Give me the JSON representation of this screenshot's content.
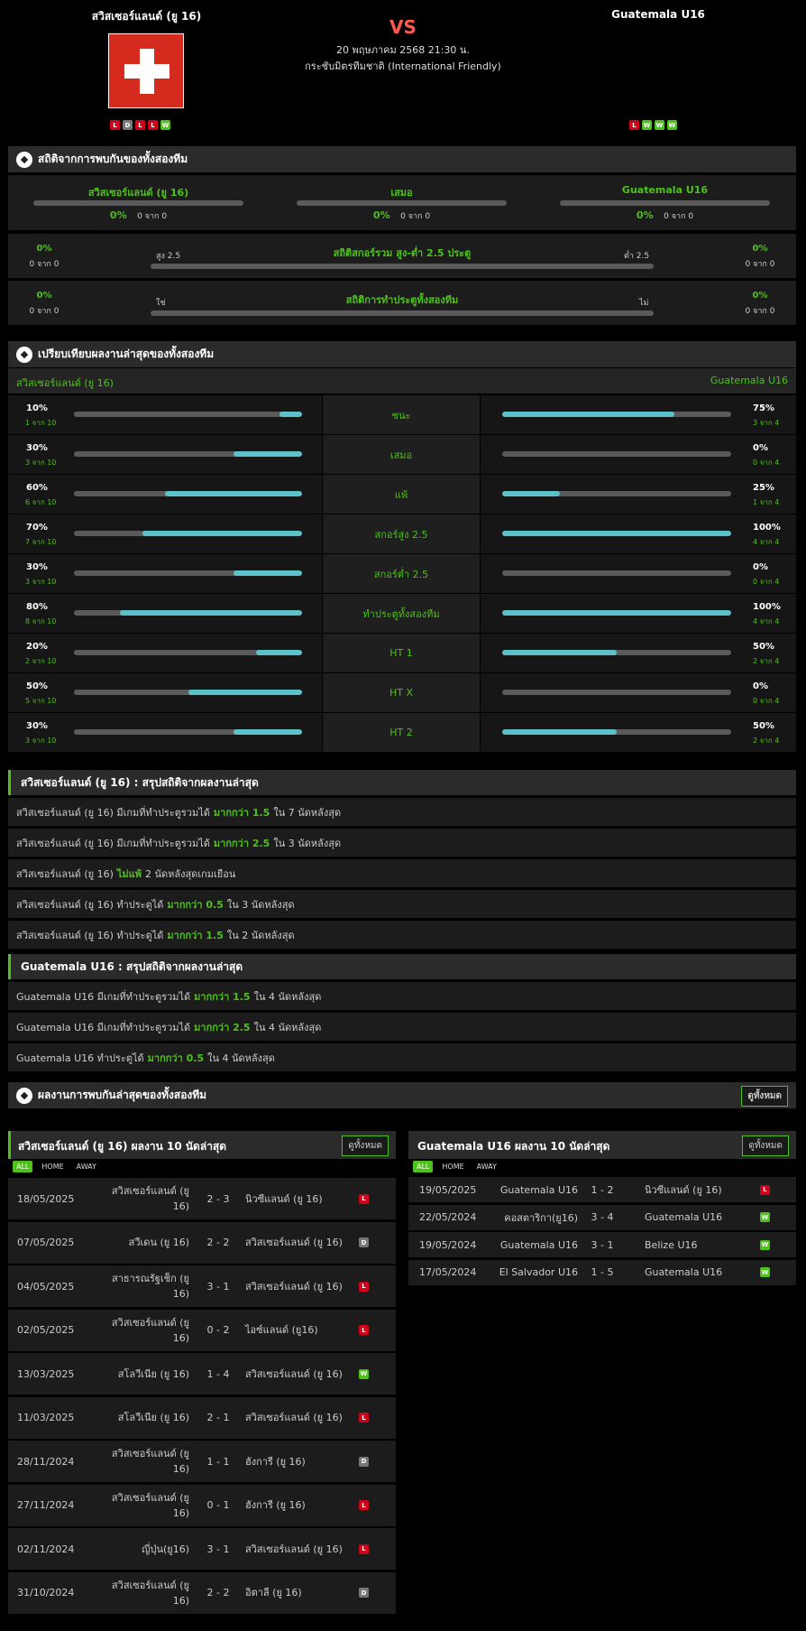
{
  "match": {
    "home": "สวิสเซอร์แลนด์ (ยู 16)",
    "away": "Guatemala U16",
    "vs": "VS",
    "datetime": "20 พฤษภาคม 2568 21:30 น.",
    "competition": "กระชับมิตรทีมชาติ (International Friendly)",
    "home_form": [
      "L",
      "D",
      "L",
      "L",
      "W"
    ],
    "away_form": [
      "L",
      "W",
      "W",
      "W"
    ]
  },
  "h2h": {
    "title": "สถิติจากการพบกันของทั้งสองทีม",
    "cols": [
      {
        "label": "สวิสเซอร์แลนด์ (ยู 16)",
        "pct": "0%",
        "of": "0 จาก 0"
      },
      {
        "label": "เสมอ",
        "pct": "0%",
        "of": "0 จาก 0"
      },
      {
        "label": "Guatemala U16",
        "pct": "0%",
        "of": "0 จาก 0"
      }
    ],
    "ou": {
      "title": "สถิติสกอร์รวม สูง-ต่ำ 2.5 ประตู",
      "left_label": "สูง 2.5",
      "right_label": "ต่ำ 2.5",
      "left_pct": "0%",
      "left_of": "0 จาก 0",
      "right_pct": "0%",
      "right_of": "0 จาก 0"
    },
    "btts": {
      "title": "สถิติการทำประตูทั้งสองทีม",
      "left_label": "ใช่",
      "right_label": "ไม่",
      "left_pct": "0%",
      "left_of": "0 จาก 0",
      "right_pct": "0%",
      "right_of": "0 จาก 0"
    }
  },
  "compare": {
    "title": "เปรียบเทียบผลงานล่าสุดของทั้งสองทีม",
    "home": "สวิสเซอร์แลนด์ (ยู 16)",
    "away": "Guatemala U16",
    "rows": [
      {
        "label": "ชนะ",
        "lp": "10%",
        "lc": "1 จาก 10",
        "lv": 0.1,
        "rp": "75%",
        "rc": "3 จาก 4",
        "rv": 0.75
      },
      {
        "label": "เสมอ",
        "lp": "30%",
        "lc": "3 จาก 10",
        "lv": 0.3,
        "rp": "0%",
        "rc": "0 จาก 4",
        "rv": 0
      },
      {
        "label": "แพ้",
        "lp": "60%",
        "lc": "6 จาก 10",
        "lv": 0.6,
        "rp": "25%",
        "rc": "1 จาก 4",
        "rv": 0.25
      },
      {
        "label": "สกอร์สูง 2.5",
        "lp": "70%",
        "lc": "7 จาก 10",
        "lv": 0.7,
        "rp": "100%",
        "rc": "4 จาก 4",
        "rv": 1.0
      },
      {
        "label": "สกอร์ต่ำ 2.5",
        "lp": "30%",
        "lc": "3 จาก 10",
        "lv": 0.3,
        "rp": "0%",
        "rc": "0 จาก 4",
        "rv": 0
      },
      {
        "label": "ทำประตูทั้งสองทีม",
        "lp": "80%",
        "lc": "8 จาก 10",
        "lv": 0.8,
        "rp": "100%",
        "rc": "4 จาก 4",
        "rv": 1.0
      },
      {
        "label": "HT 1",
        "lp": "20%",
        "lc": "2 จาก 10",
        "lv": 0.2,
        "rp": "50%",
        "rc": "2 จาก 4",
        "rv": 0.5
      },
      {
        "label": "HT X",
        "lp": "50%",
        "lc": "5 จาก 10",
        "lv": 0.5,
        "rp": "0%",
        "rc": "0 จาก 4",
        "rv": 0
      },
      {
        "label": "HT 2",
        "lp": "30%",
        "lc": "3 จาก 10",
        "lv": 0.3,
        "rp": "50%",
        "rc": "2 จาก 4",
        "rv": 0.5
      }
    ]
  },
  "home_summary": {
    "title": "สวิสเซอร์แลนด์ (ยู 16) : สรุปสถิติจากผลงานล่าสุด",
    "lines": [
      {
        "a": "สวิสเซอร์แลนด์ (ยู 16) มีเกมที่ทำประตูรวมได้",
        "b": "มากกว่า 1.5",
        "c": "ใน 7 นัดหลังสุด"
      },
      {
        "a": "สวิสเซอร์แลนด์ (ยู 16) มีเกมที่ทำประตูรวมได้",
        "b": "มากกว่า 2.5",
        "c": "ใน 3 นัดหลังสุด"
      },
      {
        "a": "สวิสเซอร์แลนด์ (ยู 16)",
        "b": "ไม่แพ้",
        "c": "2 นัดหลังสุดเกมเยือน"
      },
      {
        "a": "สวิสเซอร์แลนด์ (ยู 16) ทำประตูได้",
        "b": "มากกว่า 0.5",
        "c": "ใน 3 นัดหลังสุด"
      },
      {
        "a": "สวิสเซอร์แลนด์ (ยู 16) ทำประตูได้",
        "b": "มากกว่า 1.5",
        "c": "ใน 2 นัดหลังสุด"
      }
    ]
  },
  "away_summary": {
    "title": "Guatemala U16 : สรุปสถิติจากผลงานล่าสุด",
    "lines": [
      {
        "a": "Guatemala U16 มีเกมที่ทำประตูรวมได้",
        "b": "มากกว่า 1.5",
        "c": "ใน 4 นัดหลังสุด"
      },
      {
        "a": "Guatemala U16 มีเกมที่ทำประตูรวมได้",
        "b": "มากกว่า 2.5",
        "c": "ใน 4 นัดหลังสุด"
      },
      {
        "a": "Guatemala U16 ทำประตูได้",
        "b": "มากกว่า 0.5",
        "c": "ใน 4 นัดหลังสุด"
      }
    ]
  },
  "h2h_recent": {
    "title": "ผลงานการพบกันล่าสุดของทั้งสองทีม",
    "view_all": "ดูทั้งหมด"
  },
  "home_recent": {
    "title": "สวิสเซอร์แลนด์ (ยู 16) ผลงาน 10 นัดล่าสุด",
    "view_all": "ดูทั้งหมด",
    "tabs": [
      "ALL",
      "HOME",
      "AWAY"
    ],
    "matches": [
      {
        "date": "18/05/2025",
        "home": "สวิสเซอร์แลนด์ (ยู 16)",
        "score": "2 - 3",
        "away": "นิวซีแลนด์ (ยู 16)",
        "res": "L"
      },
      {
        "date": "07/05/2025",
        "home": "สวีเดน (ยู 16)",
        "score": "2 - 2",
        "away": "สวิสเซอร์แลนด์ (ยู 16)",
        "res": "D"
      },
      {
        "date": "04/05/2025",
        "home": "สาธารณรัฐเช็ก (ยู 16)",
        "score": "3 - 1",
        "away": "สวิสเซอร์แลนด์ (ยู 16)",
        "res": "L"
      },
      {
        "date": "02/05/2025",
        "home": "สวิสเซอร์แลนด์ (ยู 16)",
        "score": "0 - 2",
        "away": "ไอซ์แลนด์ (ยู16)",
        "res": "L"
      },
      {
        "date": "13/03/2025",
        "home": "สโลวีเนีย (ยู 16)",
        "score": "1 - 4",
        "away": "สวิสเซอร์แลนด์ (ยู 16)",
        "res": "W"
      },
      {
        "date": "11/03/2025",
        "home": "สโลวีเนีย (ยู 16)",
        "score": "2 - 1",
        "away": "สวิสเซอร์แลนด์ (ยู 16)",
        "res": "L"
      },
      {
        "date": "28/11/2024",
        "home": "สวิสเซอร์แลนด์ (ยู 16)",
        "score": "1 - 1",
        "away": "ฮังการี (ยู 16)",
        "res": "D"
      },
      {
        "date": "27/11/2024",
        "home": "สวิสเซอร์แลนด์ (ยู 16)",
        "score": "0 - 1",
        "away": "ฮังการี (ยู 16)",
        "res": "L"
      },
      {
        "date": "02/11/2024",
        "home": "ญี่ปุ่น(ยู16)",
        "score": "3 - 1",
        "away": "สวิสเซอร์แลนด์ (ยู 16)",
        "res": "L"
      },
      {
        "date": "31/10/2024",
        "home": "สวิสเซอร์แลนด์ (ยู 16)",
        "score": "2 - 2",
        "away": "อิตาลี (ยู 16)",
        "res": "D"
      }
    ]
  },
  "away_recent": {
    "title": "Guatemala U16 ผลงาน 10 นัดล่าสุด",
    "view_all": "ดูทั้งหมด",
    "tabs": [
      "ALL",
      "HOME",
      "AWAY"
    ],
    "matches": [
      {
        "date": "19/05/2025",
        "home": "Guatemala U16",
        "score": "1 - 2",
        "away": "นิวซีแลนด์ (ยู 16)",
        "res": "L"
      },
      {
        "date": "22/05/2024",
        "home": "คอสตาริกา(ยู16)",
        "score": "3 - 4",
        "away": "Guatemala U16",
        "res": "W"
      },
      {
        "date": "19/05/2024",
        "home": "Guatemala U16",
        "score": "3 - 1",
        "away": "Belize U16",
        "res": "W"
      },
      {
        "date": "17/05/2024",
        "home": "El Salvador U16",
        "score": "1 - 5",
        "away": "Guatemala U16",
        "res": "W"
      }
    ]
  },
  "colors": {
    "accent": "#4ec11c",
    "bar": "#5bc2c9",
    "loss": "#d0021b",
    "vs": "#ff5a4e"
  }
}
